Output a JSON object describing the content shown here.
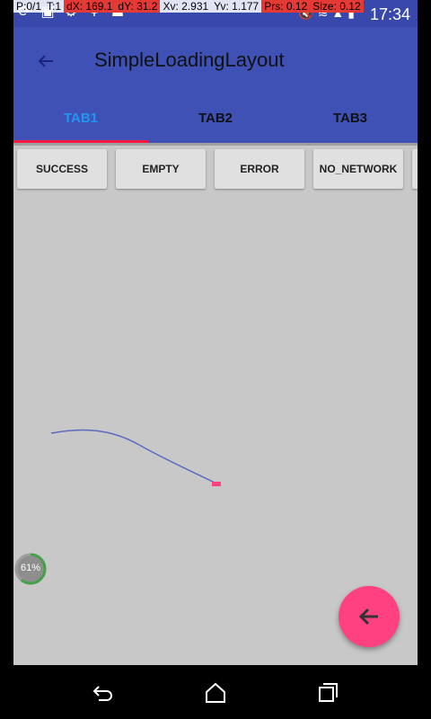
{
  "debug": {
    "pointer": "P:0/1",
    "touch": "T:1",
    "dx": "dX: 169.1",
    "dy": "dY: 31.2",
    "xv": "Xv: 2.931",
    "yv": "Yv: 1.177",
    "prs": "Prs: 0.12",
    "size": "Size: 0.12"
  },
  "status": {
    "time": "17:34"
  },
  "toolbar": {
    "title": "SimpleLoadingLayout"
  },
  "tabs": [
    {
      "label": "TAB1"
    },
    {
      "label": "TAB2"
    },
    {
      "label": "TAB3"
    }
  ],
  "buttons": [
    {
      "label": "SUCCESS"
    },
    {
      "label": "EMPTY"
    },
    {
      "label": "ERROR"
    },
    {
      "label": "NO_NETWORK"
    }
  ],
  "progress": {
    "label": "61%",
    "value": 0.61
  },
  "colors": {
    "primary": "#3f51b5",
    "status_bar": "#3949ab",
    "accent": "#ff4081",
    "indicator": "#ff1744",
    "active_tab": "#2196f3"
  }
}
